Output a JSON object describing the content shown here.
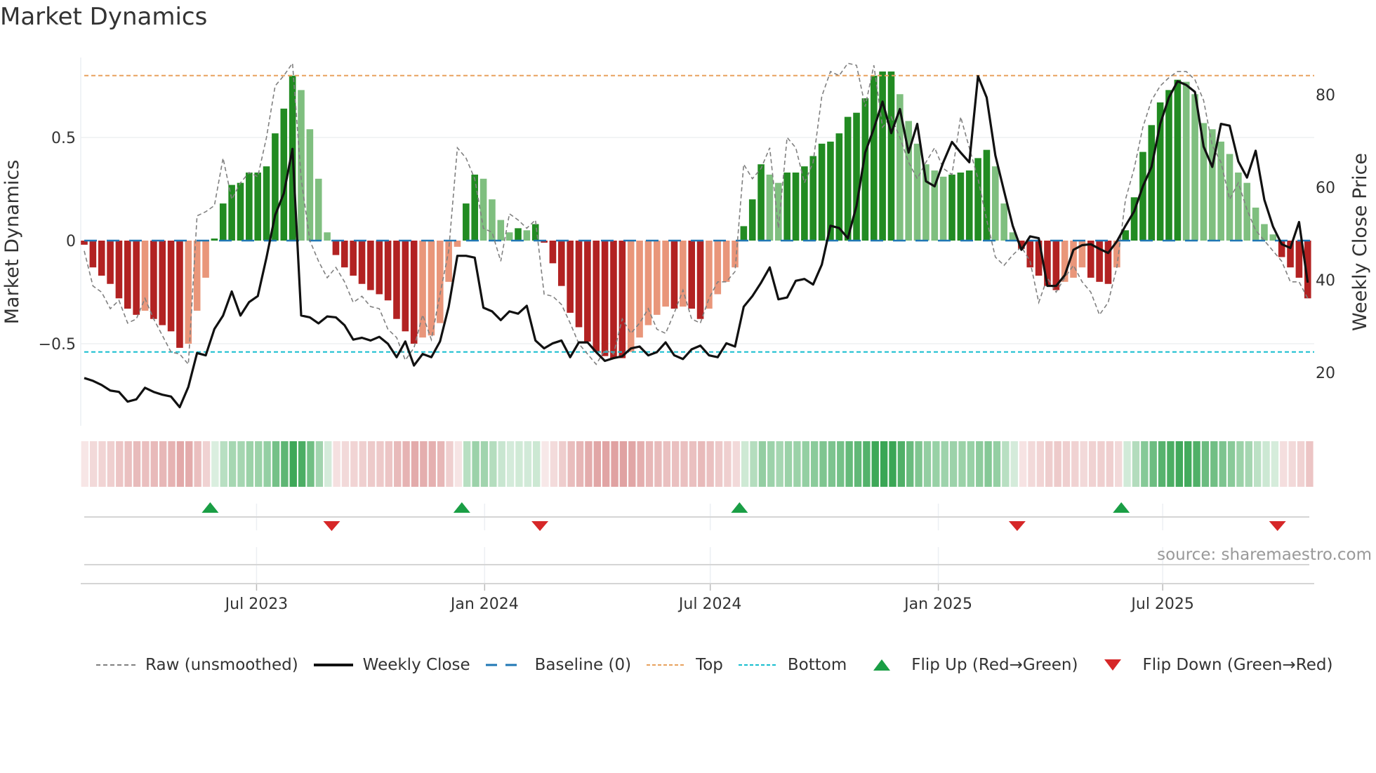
{
  "title": "Market Dynamics",
  "source": "source: sharemaestro.com",
  "legend": {
    "raw": "Raw (unsmoothed)",
    "close": "Weekly Close",
    "baseline": "Baseline (0)",
    "top": "Top",
    "bottom": "Bottom",
    "flip_up": "Flip Up (Red→Green)",
    "flip_down": "Flip Down (Green→Red)"
  },
  "colors": {
    "green_strong": "#228b22",
    "green_weak": "#7fbf7f",
    "red_strong": "#b22222",
    "red_weak": "#e9967a",
    "baseline": "#1f77b4",
    "top": "#e8a25e",
    "bottom": "#17becf",
    "raw": "#808080",
    "close": "#111111",
    "flip_up": "#1a9e45",
    "flip_down": "#d62728"
  },
  "chart_data": {
    "type": "bar+line",
    "title": "Market Dynamics",
    "ylabel": "Market Dynamics",
    "y2label": "Weekly Close Price",
    "ylim": [
      -0.78,
      0.9
    ],
    "y2lim": [
      7.6,
      88.5
    ],
    "yticks": [
      {
        "v": 0.5,
        "label": "0.5"
      },
      {
        "v": 0,
        "label": "0"
      },
      {
        "v": -0.5,
        "label": "−0.5"
      }
    ],
    "y2ticks": [
      {
        "v": 80,
        "label": "80"
      },
      {
        "v": 60,
        "label": "60"
      },
      {
        "v": 40,
        "label": "40"
      },
      {
        "v": 20,
        "label": "20"
      }
    ],
    "start_date": "2023-02-12",
    "frequency": "weekly",
    "xticks": [
      {
        "date": "2023-07-01",
        "label": "Jul 2023"
      },
      {
        "date": "2024-01-01",
        "label": "Jan 2024"
      },
      {
        "date": "2024-07-01",
        "label": "Jul 2024"
      },
      {
        "date": "2025-01-01",
        "label": "Jan 2025"
      },
      {
        "date": "2025-07-01",
        "label": "Jul 2025"
      }
    ],
    "top_level": 0.8,
    "bottom_level": -0.54,
    "baseline": 0,
    "momentum": [
      -0.02,
      -0.13,
      -0.17,
      -0.21,
      -0.28,
      -0.33,
      -0.36,
      -0.34,
      -0.38,
      -0.41,
      -0.44,
      -0.52,
      -0.5,
      -0.34,
      -0.18,
      0.01,
      0.18,
      0.27,
      0.28,
      0.33,
      0.33,
      0.36,
      0.52,
      0.64,
      0.8,
      0.73,
      0.54,
      0.3,
      0.04,
      -0.07,
      -0.13,
      -0.17,
      -0.21,
      -0.24,
      -0.26,
      -0.29,
      -0.38,
      -0.44,
      -0.5,
      -0.47,
      -0.46,
      -0.4,
      -0.2,
      -0.03,
      0.18,
      0.32,
      0.3,
      0.2,
      0.1,
      0.04,
      0.06,
      0.05,
      0.08,
      -0.01,
      -0.11,
      -0.22,
      -0.35,
      -0.42,
      -0.49,
      -0.54,
      -0.56,
      -0.57,
      -0.57,
      -0.54,
      -0.47,
      -0.41,
      -0.36,
      -0.32,
      -0.33,
      -0.32,
      -0.33,
      -0.38,
      -0.33,
      -0.26,
      -0.2,
      -0.13,
      0.07,
      0.2,
      0.37,
      0.32,
      0.28,
      0.33,
      0.33,
      0.36,
      0.41,
      0.47,
      0.48,
      0.52,
      0.6,
      0.62,
      0.69,
      0.8,
      0.82,
      0.82,
      0.71,
      0.58,
      0.47,
      0.37,
      0.34,
      0.31,
      0.32,
      0.33,
      0.34,
      0.4,
      0.44,
      0.36,
      0.18,
      0.04,
      -0.04,
      -0.13,
      -0.17,
      -0.22,
      -0.24,
      -0.2,
      -0.18,
      -0.13,
      -0.18,
      -0.2,
      -0.21,
      -0.13,
      0.05,
      0.21,
      0.43,
      0.56,
      0.67,
      0.73,
      0.78,
      0.77,
      0.71,
      0.57,
      0.54,
      0.48,
      0.42,
      0.33,
      0.28,
      0.16,
      0.08,
      0.03,
      -0.08,
      -0.13,
      -0.18,
      -0.28
    ],
    "raw": [
      -0.05,
      -0.22,
      -0.25,
      -0.33,
      -0.29,
      -0.4,
      -0.38,
      -0.28,
      -0.38,
      -0.46,
      -0.54,
      -0.55,
      -0.6,
      0.12,
      0.14,
      0.17,
      0.4,
      0.2,
      0.28,
      0.33,
      0.31,
      0.5,
      0.75,
      0.8,
      0.86,
      0.3,
      0.0,
      -0.1,
      -0.18,
      -0.13,
      -0.2,
      -0.3,
      -0.27,
      -0.32,
      -0.33,
      -0.43,
      -0.47,
      -0.58,
      -0.52,
      -0.36,
      -0.48,
      -0.26,
      -0.05,
      0.45,
      0.4,
      0.3,
      0.06,
      0.04,
      -0.1,
      0.13,
      0.1,
      0.06,
      0.1,
      -0.26,
      -0.27,
      -0.31,
      -0.4,
      -0.5,
      -0.55,
      -0.6,
      -0.53,
      -0.55,
      -0.38,
      -0.45,
      -0.4,
      -0.33,
      -0.43,
      -0.45,
      -0.35,
      -0.24,
      -0.38,
      -0.4,
      -0.28,
      -0.2,
      -0.2,
      -0.15,
      0.37,
      0.3,
      0.35,
      0.45,
      0.06,
      0.5,
      0.45,
      0.28,
      0.38,
      0.7,
      0.82,
      0.8,
      0.86,
      0.85,
      0.65,
      0.85,
      0.55,
      0.6,
      0.5,
      0.38,
      0.3,
      0.38,
      0.45,
      0.35,
      0.32,
      0.6,
      0.45,
      0.3,
      0.1,
      -0.08,
      -0.12,
      -0.07,
      -0.03,
      -0.1,
      -0.3,
      -0.18,
      -0.25,
      -0.18,
      -0.12,
      -0.2,
      -0.25,
      -0.36,
      -0.3,
      -0.13,
      0.2,
      0.35,
      0.55,
      0.68,
      0.75,
      0.79,
      0.82,
      0.82,
      0.78,
      0.68,
      0.46,
      0.38,
      0.2,
      0.28,
      0.15,
      0.05,
      0.0,
      -0.05,
      -0.1,
      -0.2,
      -0.2,
      -0.28
    ],
    "close": [
      18.8,
      18.2,
      17.3,
      16.1,
      15.8,
      13.7,
      14.2,
      16.7,
      15.8,
      15.2,
      14.8,
      12.5,
      16.9,
      24.2,
      23.7,
      29.4,
      32.3,
      37.5,
      32.3,
      35.2,
      36.5,
      44.8,
      54.0,
      58.7,
      68.3,
      32.3,
      31.9,
      30.6,
      32.1,
      31.9,
      30.2,
      27.1,
      27.5,
      26.9,
      27.7,
      26.2,
      23.3,
      26.7,
      21.5,
      24.0,
      23.3,
      26.7,
      34.2,
      45.2,
      45.2,
      44.8,
      34.0,
      33.2,
      31.3,
      33.2,
      32.7,
      34.4,
      26.9,
      25.2,
      26.3,
      26.9,
      23.3,
      26.5,
      26.5,
      24.4,
      22.5,
      23.1,
      23.5,
      25.2,
      25.6,
      23.7,
      24.4,
      26.5,
      23.7,
      22.9,
      25.0,
      25.8,
      23.7,
      23.3,
      26.3,
      25.6,
      34.2,
      36.5,
      39.4,
      42.7,
      35.8,
      36.2,
      39.8,
      40.2,
      39.0,
      43.3,
      51.7,
      51.2,
      49.0,
      56.0,
      67.5,
      72.7,
      78.5,
      71.7,
      76.9,
      67.5,
      73.7,
      61.3,
      60.2,
      65.4,
      69.8,
      67.5,
      65.4,
      84.0,
      79.4,
      66.9,
      59.2,
      51.7,
      46.5,
      49.4,
      49.0,
      38.7,
      38.7,
      41.0,
      46.5,
      47.5,
      47.7,
      46.7,
      45.8,
      48.3,
      51.7,
      54.8,
      60.2,
      64.4,
      73.7,
      79.4,
      82.9,
      82.1,
      80.6,
      68.8,
      64.4,
      73.7,
      73.3,
      65.6,
      62.1,
      67.9,
      57.3,
      51.5,
      47.7,
      46.9,
      52.5,
      39.4
    ],
    "flip_up_weeks": [
      15,
      44,
      76,
      120
    ],
    "flip_down_weeks": [
      29,
      53,
      108,
      138
    ],
    "legend_position": "bottom"
  }
}
